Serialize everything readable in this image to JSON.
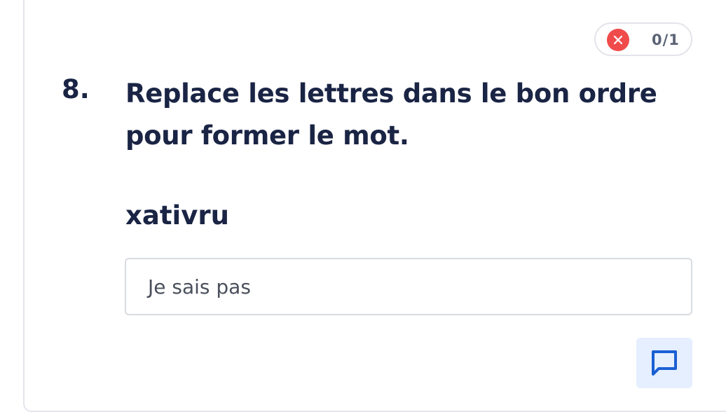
{
  "score": {
    "status": "wrong",
    "value": "0/1",
    "status_color": "#f04b4b"
  },
  "question": {
    "number": "8.",
    "line1": "Replace les lettres dans le bon ordre",
    "line2": "pour former le mot.",
    "scrambled_word": "xativru"
  },
  "answer": {
    "value": "Je sais pas"
  },
  "actions": {
    "comment_icon": "comment-icon",
    "accent_color": "#1a5fd4"
  }
}
